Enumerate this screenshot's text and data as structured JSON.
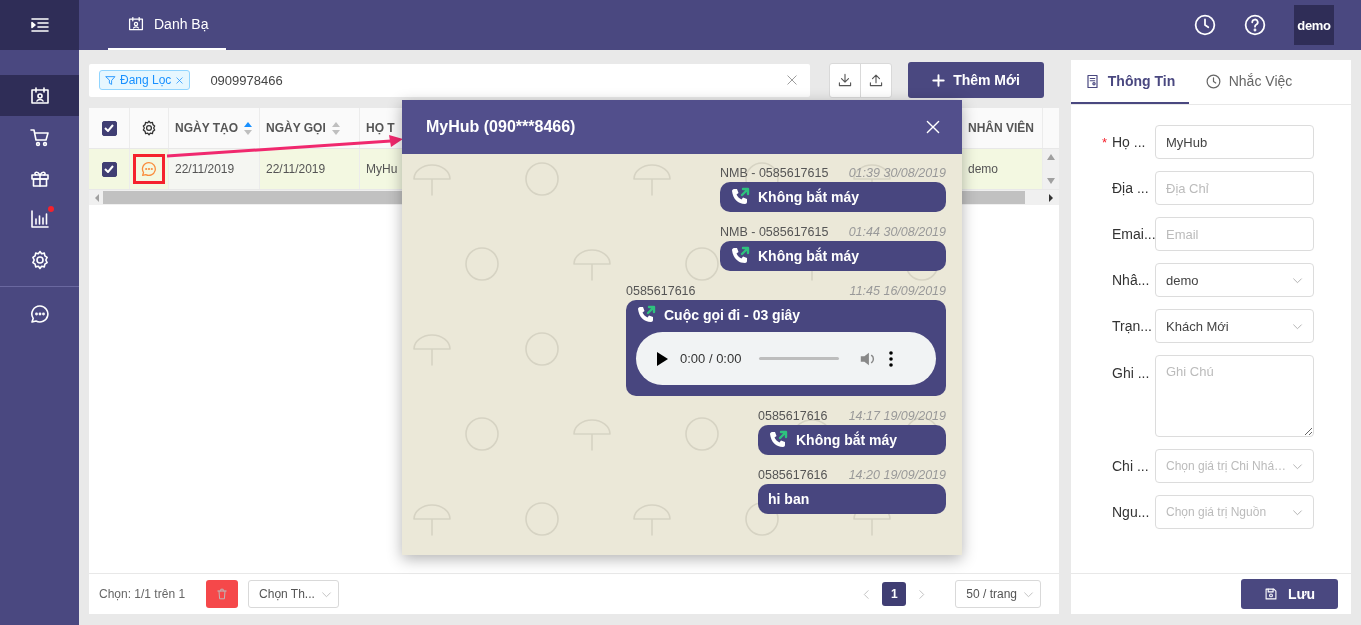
{
  "sidebar": {
    "collapsed": true,
    "items": [
      {
        "selected": true,
        "alert": false
      },
      {
        "selected": false,
        "alert": false
      },
      {
        "selected": false,
        "alert": false
      },
      {
        "selected": false,
        "alert": true
      },
      {
        "selected": false,
        "alert": false
      },
      {
        "selected": false,
        "alert": false
      }
    ]
  },
  "tabs": [
    {
      "label": "Danh Bạ",
      "selected": true
    }
  ],
  "user": {
    "name": "demo"
  },
  "filter": {
    "tag": "Đang Lọc",
    "value": "0909978466"
  },
  "add_button": "Thêm Mới",
  "table": {
    "select_all": {
      "checked": true
    },
    "columns": [
      {
        "label": "NGÀY TẠO",
        "sortable": true,
        "sorted": true
      },
      {
        "label": "NGÀY GỌI",
        "sortable": true,
        "sorted": false
      },
      {
        "label": "HỌ T"
      },
      {
        "label": "NHÂN VIÊN"
      }
    ],
    "rows": [
      {
        "checked": true,
        "cells": [
          "22/11/2019",
          "22/11/2019",
          "MyHu",
          "demo"
        ]
      }
    ]
  },
  "footer": {
    "selection": "Chọn: 1/1 trên 1",
    "bulk_action": "Chọn Th...",
    "pages": [
      {
        "label": "1",
        "selected": true
      }
    ],
    "page_size": "50 / trang"
  },
  "chat": {
    "title": "MyHub (090***8466)",
    "messages": [
      {
        "kind": "missed_call",
        "sender": "NMB - 0585617615",
        "time": "01:39 30/08/2019",
        "text": "Không bắt máy"
      },
      {
        "kind": "missed_call",
        "sender": "NMB - 0585617615",
        "time": "01:44 30/08/2019",
        "text": "Không bắt máy"
      },
      {
        "kind": "recording",
        "sender": "0585617616",
        "time": "11:45 16/09/2019",
        "text": "Cuộc gọi đi - 03 giây",
        "player_time": "0:00 / 0:00"
      },
      {
        "kind": "missed_call",
        "sender": "0585617616",
        "time": "14:17 19/09/2019",
        "text": "Không bắt máy"
      },
      {
        "kind": "text",
        "sender": "0585617616",
        "time": "14:20 19/09/2019",
        "text": "hi ban"
      }
    ]
  },
  "detail": {
    "tabs": [
      {
        "label": "Thông Tin",
        "selected": true
      },
      {
        "label": "Nhắc Việc",
        "selected": false
      }
    ],
    "fields": [
      {
        "kind": "input",
        "marker": "*",
        "label": "Họ ...",
        "value": "MyHub"
      },
      {
        "kind": "input",
        "label": "Địa ...",
        "placeholder": "Địa Chỉ"
      },
      {
        "kind": "input",
        "label": "Emai...",
        "placeholder": "Email"
      },
      {
        "kind": "select",
        "label": "Nhâ...",
        "value": "demo"
      },
      {
        "kind": "select",
        "label": "Trạn...",
        "value": "Khách Mới"
      },
      {
        "kind": "textarea",
        "label": "Ghi ...",
        "placeholder": "Ghi Chú"
      },
      {
        "kind": "select",
        "label": "Chi ...",
        "placeholder": "Chọn giá trị Chi Nhá…"
      },
      {
        "kind": "select",
        "label": "Ngu...",
        "placeholder": "Chọn giá trị Nguồn"
      }
    ],
    "save_button": "Lưu"
  }
}
